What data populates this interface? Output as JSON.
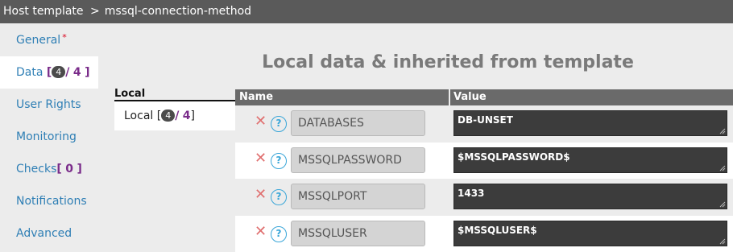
{
  "breadcrumb": {
    "root": "Host template",
    "separator": ">",
    "current": "mssql-connection-method"
  },
  "sidebar": {
    "items": [
      {
        "label": "General",
        "required_mark": "*"
      },
      {
        "label": "Data",
        "bracket_open": "[",
        "local_count": "4",
        "slash": "/",
        "total": "4",
        "bracket_close": "]"
      },
      {
        "label": "User Rights"
      },
      {
        "label": "Monitoring"
      },
      {
        "label": "Checks",
        "bracket_open": "[",
        "count": "0",
        "bracket_close": "]"
      },
      {
        "label": "Notifications"
      },
      {
        "label": "Advanced"
      }
    ]
  },
  "main": {
    "title": "Local data & inherited from template"
  },
  "subnav": {
    "header": "Local",
    "item": {
      "label": "Local",
      "bracket_open": "[",
      "count": "4",
      "slash": "/",
      "total": "4",
      "bracket_close": "]"
    }
  },
  "table": {
    "headers": {
      "name": "Name",
      "value": "Value"
    },
    "delete_glyph": "✕",
    "help_glyph": "?",
    "rows": [
      {
        "name": "DATABASES",
        "value": "DB-UNSET"
      },
      {
        "name": "MSSQLPASSWORD",
        "value": "$MSSQLPASSWORD$"
      },
      {
        "name": "MSSQLPORT",
        "value": "1433"
      },
      {
        "name": "MSSQLUSER",
        "value": "$MSSQLUSER$"
      }
    ]
  },
  "colors": {
    "topbar": "#5a5a5a",
    "link": "#2f7fb5",
    "accent_purple": "#7a2c8a",
    "value_bg": "#3c3c3c",
    "delete": "#e07070",
    "help": "#3aa6d8"
  }
}
